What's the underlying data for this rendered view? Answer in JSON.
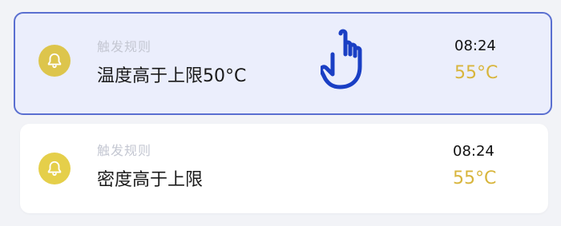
{
  "alerts": [
    {
      "rule_title": "触发规则",
      "rule_text": "温度高于上限50°C",
      "time": "08:24",
      "value": "55°C",
      "selected": true
    },
    {
      "rule_title": "触发规则",
      "rule_text": "密度高于上限",
      "time": "08:24",
      "value": "55°C",
      "selected": false
    }
  ],
  "colors": {
    "bell_bg": "#ddc54c",
    "value_text": "#d8b53c",
    "selected_border": "#5a6fd0",
    "selected_bg": "#ebeefc",
    "pointer": "#1a3fc4"
  },
  "icons": {
    "alert_icon": "bell-icon",
    "pointer_icon": "tap-hand-icon"
  }
}
